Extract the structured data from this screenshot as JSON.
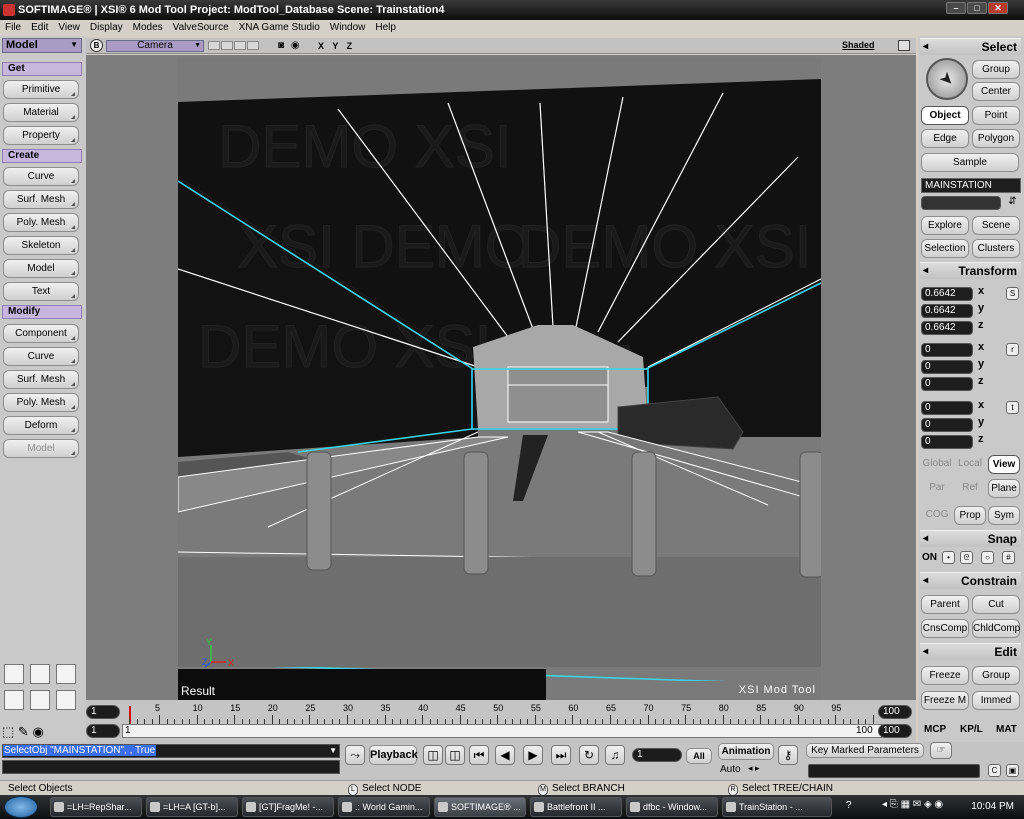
{
  "window": {
    "title": "SOFTIMAGE® | XSI® 6 Mod Tool Project: ModTool_Database    Scene: Trainstation4",
    "brand": "SOFTIMAGE | XSI"
  },
  "menu": [
    "File",
    "Edit",
    "View",
    "Display",
    "Modes",
    "ValveSource",
    "XNA Game Studio",
    "Window",
    "Help"
  ],
  "left": {
    "module": "Model",
    "get_label": "Get",
    "get": [
      "Primitive",
      "Material",
      "Property"
    ],
    "create_label": "Create",
    "create": [
      "Curve",
      "Surf. Mesh",
      "Poly. Mesh",
      "Skeleton",
      "Model",
      "Text"
    ],
    "modify_label": "Modify",
    "modify": [
      "Component",
      "Curve",
      "Surf. Mesh",
      "Poly. Mesh",
      "Deform",
      "Model"
    ]
  },
  "viewport": {
    "camera": "Camera",
    "axes": "X Y Z",
    "mode": "Shaded",
    "result_label": "Result",
    "watermark": "XSI DEMO",
    "footer_logo": "XSI Mod Tool",
    "colors": {
      "background": "#111111",
      "floor": "#7a7a7a",
      "selection": "#3ad4e8",
      "wire": "#ffffff"
    }
  },
  "timeline": {
    "start": "1",
    "end": "100",
    "current": "1",
    "range_start": "1",
    "range_end": "100",
    "ticks": [
      5,
      10,
      15,
      20,
      25,
      30,
      35,
      40,
      45,
      50,
      55,
      60,
      65,
      70,
      75,
      80,
      85,
      90,
      95
    ]
  },
  "right": {
    "select_title": "Select",
    "group": "Group",
    "center": "Center",
    "object": "Object",
    "point": "Point",
    "edge": "Edge",
    "polygon": "Polygon",
    "sample": "Sample",
    "selection_name": "MAINSTATION",
    "explore": "Explore",
    "scene": "Scene",
    "selection": "Selection",
    "clusters": "Clusters",
    "transform_title": "Transform",
    "scale": [
      "0.6642",
      "0.6642",
      "0.6642"
    ],
    "rotate": [
      "0",
      "0",
      "0"
    ],
    "translate": [
      "0",
      "0",
      "0"
    ],
    "axes": [
      "x",
      "y",
      "z"
    ],
    "s": "S",
    "r": "r",
    "t": "t",
    "global": "Global",
    "local": "Local",
    "view": "View",
    "par": "Par",
    "ref": "Ref",
    "plane": "Plane",
    "cog": "COG",
    "prop": "Prop",
    "sym": "Sym",
    "snap_title": "Snap",
    "on": "ON",
    "constrain_title": "Constrain",
    "parent": "Parent",
    "cut": "Cut",
    "cnscomp": "CnsComp",
    "chldcomp": "ChldComp",
    "edit_title": "Edit",
    "freeze": "Freeze",
    "group2": "Group",
    "freeze_m": "Freeze M",
    "immed": "Immed",
    "tabs": [
      "MCP",
      "KP/L",
      "MAT"
    ]
  },
  "command": {
    "script": "SelectObj \"MAINSTATION\", , True",
    "playback": "Playback",
    "frame": "1",
    "all": "All",
    "animation": "Animation",
    "auto": "Auto",
    "key_marked": "Key Marked Parameters"
  },
  "status": {
    "left": "Select Objects",
    "l_btn": "L",
    "l_text": "Select NODE",
    "m_btn": "M",
    "m_text": "Select BRANCH",
    "r_btn": "R",
    "r_text": "Select TREE/CHAIN"
  },
  "taskbar": {
    "items": [
      "=LH=RepShar...",
      "=LH=A [GT-b]...",
      "[GT]FragMe! -...",
      ".: World Gamin...",
      "SOFTIMAGE® ...",
      "Battlefront II ...",
      "dfbc - Window...",
      "TrainStation - ..."
    ],
    "active_index": 4,
    "clock": "10:04 PM"
  }
}
